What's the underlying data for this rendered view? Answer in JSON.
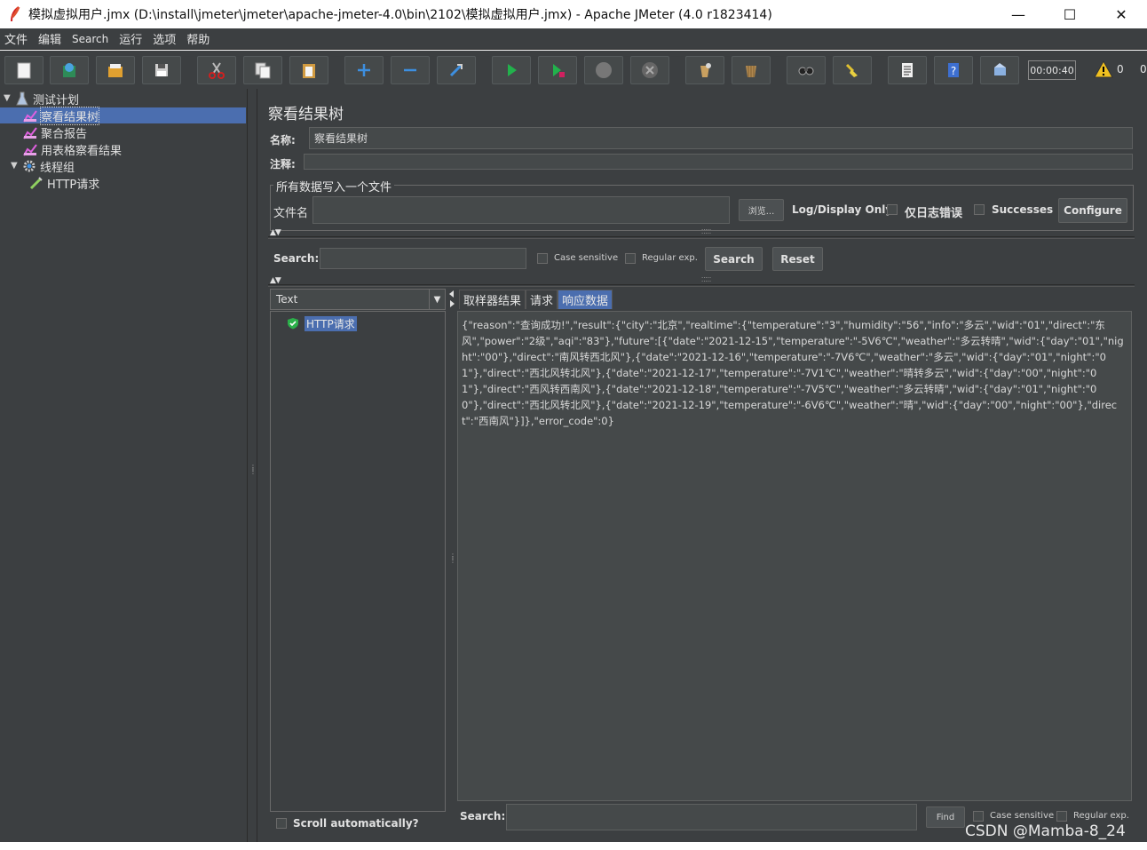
{
  "window": {
    "title": "模拟虚拟用户.jmx (D:\\install\\jmeter\\jmeter\\apache-jmeter-4.0\\bin\\2102\\模拟虚拟用户.jmx) - Apache JMeter (4.0 r1823414)",
    "minimize": "—",
    "maximize": "☐",
    "close": "✕"
  },
  "menu": [
    "文件",
    "编辑",
    "Search",
    "运行",
    "选项",
    "帮助"
  ],
  "toolbar": {
    "timer": "00:00:40",
    "warnings": "0",
    "errors": "0",
    "icons": [
      "new-icon",
      "templates-icon",
      "open-icon",
      "save-icon",
      "cut-icon",
      "copy-icon",
      "paste-icon",
      "expand-icon",
      "collapse-icon",
      "toggle-icon",
      "start-icon",
      "start-no-pause-icon",
      "stop-icon",
      "shutdown-icon",
      "clear-icon",
      "clear-all-icon",
      "search-icon",
      "reset-search-icon",
      "function-helper-icon",
      "help-icon",
      "remote-icon"
    ]
  },
  "tree": {
    "items": [
      {
        "label": "测试计划",
        "icon": "test-plan-icon",
        "expanded": true
      },
      {
        "label": "察看结果树",
        "icon": "listener-icon",
        "selected": true
      },
      {
        "label": "聚合报告",
        "icon": "listener-icon"
      },
      {
        "label": "用表格察看结果",
        "icon": "listener-icon"
      },
      {
        "label": "线程组",
        "icon": "gear-icon",
        "expanded": true
      },
      {
        "label": "HTTP请求",
        "icon": "sampler-icon"
      }
    ]
  },
  "panel": {
    "title": "察看结果树",
    "name_label": "名称:",
    "name_value": "察看结果树",
    "comment_label": "注释:",
    "comment_value": "",
    "file_group_title": "所有数据写入一个文件",
    "filename_label": "文件名",
    "filename_value": "",
    "browse": "浏览...",
    "log_display_only": "Log/Display Only:",
    "errors_only": "仅日志错误",
    "successes": "Successes",
    "configure": "Configure"
  },
  "search": {
    "label": "Search:",
    "value": "",
    "case_sensitive": "Case sensitive",
    "regular_exp": "Regular exp.",
    "search_button": "Search",
    "reset_button": "Reset"
  },
  "results": {
    "renderer": "Text",
    "items": [
      {
        "label": "HTTP请求",
        "status": "success"
      }
    ],
    "tabs": [
      "取样器结果",
      "请求",
      "响应数据"
    ],
    "active_tab": "响应数据",
    "response": "{\"reason\":\"查询成功!\",\"result\":{\"city\":\"北京\",\"realtime\":{\"temperature\":\"3\",\"humidity\":\"56\",\"info\":\"多云\",\"wid\":\"01\",\"direct\":\"东风\",\"power\":\"2级\",\"aqi\":\"83\"},\"future\":[{\"date\":\"2021-12-15\",\"temperature\":\"-5V6℃\",\"weather\":\"多云转晴\",\"wid\":{\"day\":\"01\",\"night\":\"00\"},\"direct\":\"南风转西北风\"},{\"date\":\"2021-12-16\",\"temperature\":\"-7V6℃\",\"weather\":\"多云\",\"wid\":{\"day\":\"01\",\"night\":\"01\"},\"direct\":\"西北风转北风\"},{\"date\":\"2021-12-17\",\"temperature\":\"-7V1℃\",\"weather\":\"晴转多云\",\"wid\":{\"day\":\"00\",\"night\":\"01\"},\"direct\":\"西风转西南风\"},{\"date\":\"2021-12-18\",\"temperature\":\"-7V5℃\",\"weather\":\"多云转晴\",\"wid\":{\"day\":\"01\",\"night\":\"00\"},\"direct\":\"西北风转北风\"},{\"date\":\"2021-12-19\",\"temperature\":\"-6V6℃\",\"weather\":\"晴\",\"wid\":{\"day\":\"00\",\"night\":\"00\"},\"direct\":\"西南风\"}]},\"error_code\":0}",
    "scroll_auto": "Scroll automatically?",
    "bottom_search_label": "Search:",
    "find": "Find",
    "case_sensitive": "Case sensitive",
    "regular_exp": "Regular exp."
  },
  "watermark": "CSDN @Mamba-8_24"
}
